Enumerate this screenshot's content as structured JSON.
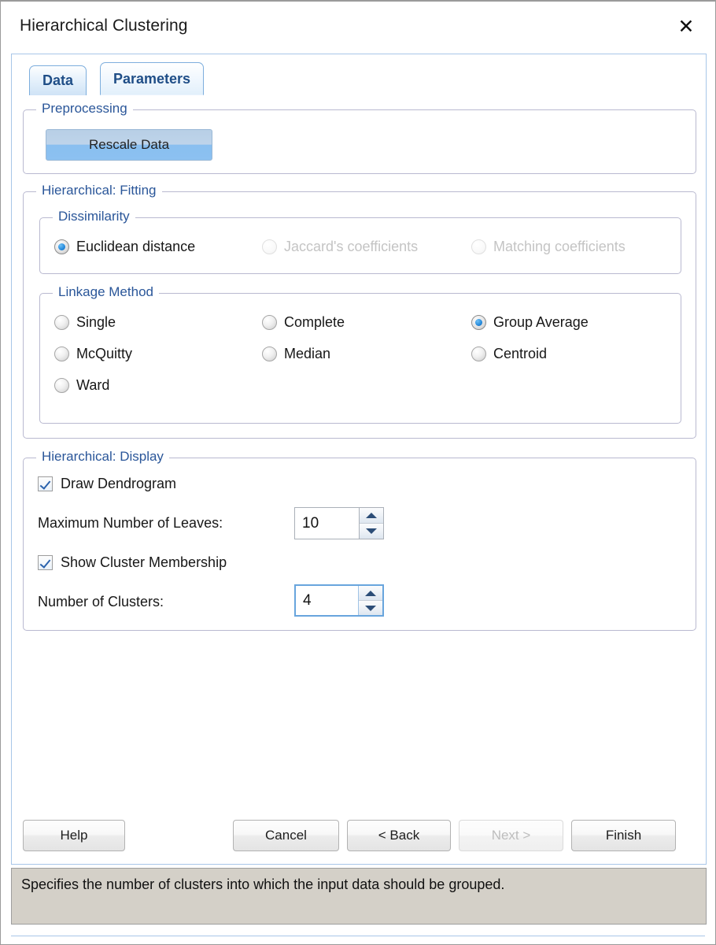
{
  "window": {
    "title": "Hierarchical Clustering",
    "close_icon": "close-icon",
    "close_glyph": "✕"
  },
  "tabs": [
    {
      "label": "Data",
      "active": false
    },
    {
      "label": "Parameters",
      "active": true
    }
  ],
  "preprocessing": {
    "legend": "Preprocessing",
    "rescale_button": "Rescale Data"
  },
  "fitting": {
    "legend": "Hierarchical: Fitting",
    "dissimilarity": {
      "legend": "Dissimilarity",
      "options": [
        {
          "label": "Euclidean distance",
          "selected": true,
          "disabled": false
        },
        {
          "label": "Jaccard's coefficients",
          "selected": false,
          "disabled": true
        },
        {
          "label": "Matching coefficients",
          "selected": false,
          "disabled": true
        }
      ]
    },
    "linkage": {
      "legend": "Linkage Method",
      "options": [
        {
          "label": "Single",
          "selected": false
        },
        {
          "label": "Complete",
          "selected": false
        },
        {
          "label": "Group Average",
          "selected": true
        },
        {
          "label": "McQuitty",
          "selected": false
        },
        {
          "label": "Median",
          "selected": false
        },
        {
          "label": "Centroid",
          "selected": false
        },
        {
          "label": "Ward",
          "selected": false
        }
      ]
    }
  },
  "display": {
    "legend": "Hierarchical: Display",
    "draw_dendrogram": {
      "label": "Draw Dendrogram",
      "checked": true
    },
    "max_leaves": {
      "label": "Maximum Number of Leaves:",
      "value": "10",
      "focused": false
    },
    "show_cluster_membership": {
      "label": "Show Cluster Membership",
      "checked": true
    },
    "num_clusters": {
      "label": "Number of Clusters:",
      "value": "4",
      "focused": true
    }
  },
  "footer": {
    "help": "Help",
    "cancel": "Cancel",
    "back": "< Back",
    "next": "Next >",
    "finish": "Finish"
  },
  "status": {
    "text": "Specifies the number of clusters into which the input data should be grouped."
  },
  "colors": {
    "accent_blue": "#2a5699",
    "tab_border": "#7daedd",
    "panel_border": "#a8c6e8",
    "group_border": "#b9b9d0",
    "radio_dot": "#2a8ede",
    "check_mark": "#2a62ad",
    "status_bg": "#d4d0c8",
    "rescale_bg": "#8cc1f1"
  }
}
